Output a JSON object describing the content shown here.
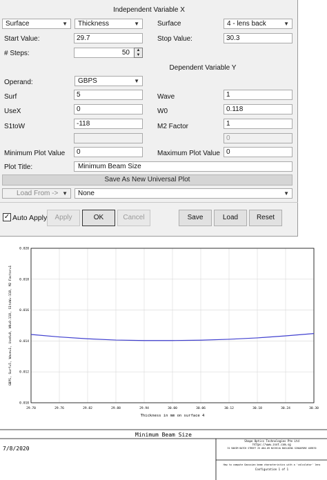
{
  "independent": {
    "title": "Independent Variable X",
    "type_select": "Surface",
    "param_select": "Thickness",
    "surface_label": "Surface",
    "surface_select": "4 - lens back",
    "start_label": "Start Value:",
    "start_value": "29.7",
    "stop_label": "Stop Value:",
    "stop_value": "30.3",
    "steps_label": "# Steps:",
    "steps_value": "50"
  },
  "dependent": {
    "title": "Dependent Variable Y",
    "operand_label": "Operand:",
    "operand_select": "GBPS",
    "surf_label": "Surf",
    "surf_value": "5",
    "wave_label": "Wave",
    "wave_value": "1",
    "usex_label": "UseX",
    "usex_value": "0",
    "w0_label": "W0",
    "w0_value": "0.118",
    "s1tow_label": "S1toW",
    "s1tow_value": "-118",
    "m2_label": "M2 Factor",
    "m2_value": "1",
    "extra_value": "0",
    "min_label": "Minimum Plot Value",
    "min_value": "0",
    "max_label": "Maximum Plot Value",
    "max_value": "0",
    "plot_title_label": "Plot Title:",
    "plot_title_value": "Minimum Beam Size"
  },
  "actions": {
    "save_universal": "Save As New Universal Plot",
    "load_from": "Load From ->",
    "load_select": "None",
    "auto_apply": "Auto Apply",
    "auto_apply_checked": true,
    "apply": "Apply",
    "ok": "OK",
    "cancel": "Cancel",
    "save": "Save",
    "load": "Load",
    "reset": "Reset"
  },
  "icons": {
    "dropdown": "chevron-down-icon",
    "spin_up": "arrow-up-icon",
    "spin_down": "arrow-down-icon",
    "check": "checkmark-icon"
  },
  "colors": {
    "line": "#3f3fcf"
  },
  "chart_data": {
    "type": "line",
    "xlabel": "Thickness in mm on surface 4",
    "ylabel": "GBPS, Surf=5, Wave=1, UseX=0, W0=0.118, S1toW=-118, M2 Factor=1",
    "xlim": [
      29.7,
      30.3
    ],
    "ylim": [
      0.01,
      0.02
    ],
    "x_ticks": [
      "29.70",
      "29.76",
      "29.82",
      "29.88",
      "29.94",
      "30.00",
      "30.06",
      "30.12",
      "30.18",
      "30.24",
      "30.30"
    ],
    "y_ticks": [
      "0.010",
      "0.012",
      "0.014",
      "0.016",
      "0.018",
      "0.020"
    ],
    "grid": true,
    "x": [
      29.7,
      29.76,
      29.82,
      29.88,
      29.94,
      30.0,
      30.06,
      30.12,
      30.18,
      30.24,
      30.3
    ],
    "values": [
      0.01442,
      0.01426,
      0.01414,
      0.01406,
      0.01403,
      0.01403,
      0.01405,
      0.01411,
      0.0142,
      0.01433,
      0.01448
    ]
  },
  "footer": {
    "title": "Minimum Beam Size",
    "date": "7/8/2020",
    "company": "Shape Optics Technologies Pte Ltd",
    "web": "https://www.zsot.com.sg",
    "address": "31 RAHIM BATCH STREET 25 #04-09 NICHIJA BUILDING SINGAPORE 409570",
    "description": "How to compute Gaussian beam characteristics with a 'calculator' lens",
    "config": "Configuration 1 of 1"
  }
}
